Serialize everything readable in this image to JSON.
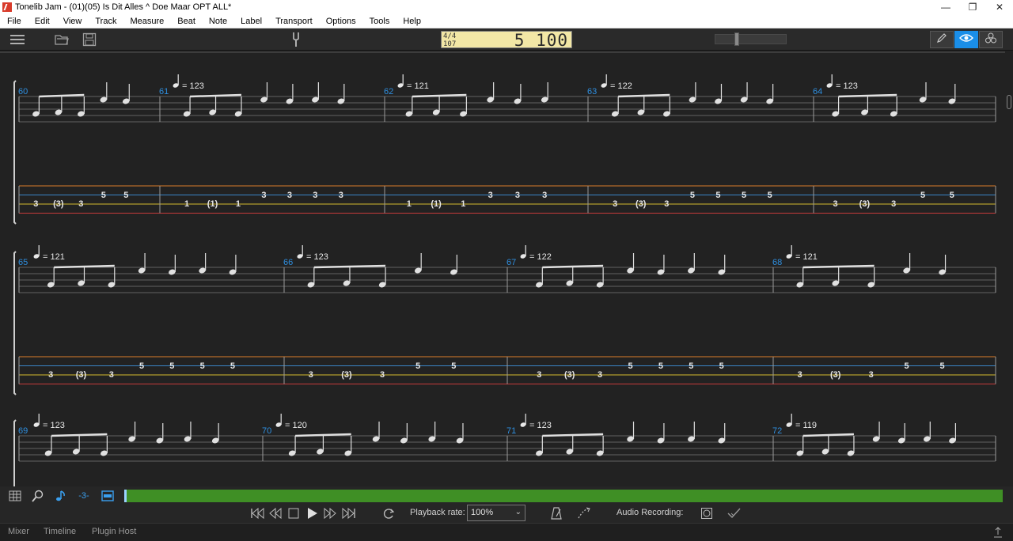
{
  "window": {
    "title": "Tonelib Jam - (01)(05) Is Dit Alles ^ Doe Maar OPT ALL*"
  },
  "menu": [
    "File",
    "Edit",
    "View",
    "Track",
    "Measure",
    "Beat",
    "Note",
    "Label",
    "Transport",
    "Options",
    "Tools",
    "Help"
  ],
  "toolbar": {
    "icons": [
      "hamburger-menu-icon",
      "open-folder-icon",
      "save-icon",
      "tuning-fork-icon",
      "pencil-icon",
      "eye-icon",
      "tracks-icon"
    ],
    "time_signature": "4/4",
    "tempo_display": "107",
    "position": "5 100"
  },
  "score": {
    "systems": [
      {
        "measures": [
          {
            "number": "60",
            "tempo": "",
            "tab": [
              [
                "3",
                "(3)",
                "3"
              ],
              [
                "5",
                "5"
              ]
            ]
          },
          {
            "number": "61",
            "tempo": "= 123",
            "tab": [
              [
                "1",
                "(1)",
                "1"
              ],
              [
                "3",
                "3",
                "3",
                "3"
              ]
            ]
          },
          {
            "number": "62",
            "tempo": "= 121",
            "tab": [
              [
                "1",
                "(1)",
                "1"
              ],
              [
                "3",
                "3",
                "3"
              ]
            ]
          },
          {
            "number": "63",
            "tempo": "= 122",
            "tab": [
              [
                "3",
                "(3)",
                "3"
              ],
              [
                "5",
                "5",
                "5",
                "5"
              ]
            ]
          },
          {
            "number": "64",
            "tempo": "= 123",
            "tab": [
              [
                "3",
                "(3)",
                "3"
              ],
              [
                "5",
                "5"
              ]
            ]
          }
        ]
      },
      {
        "measures": [
          {
            "number": "65",
            "tempo": "= 121",
            "tab": [
              [
                "3",
                "(3)",
                "3"
              ],
              [
                "5",
                "5",
                "5",
                "5"
              ]
            ]
          },
          {
            "number": "66",
            "tempo": "= 123",
            "tab": [
              [
                "3",
                "(3)",
                "3"
              ],
              [
                "5",
                "5"
              ]
            ]
          },
          {
            "number": "67",
            "tempo": "= 122",
            "tab": [
              [
                "3",
                "(3)",
                "3"
              ],
              [
                "5",
                "5",
                "5",
                "5"
              ]
            ]
          },
          {
            "number": "68",
            "tempo": "= 121",
            "tab": [
              [
                "3",
                "(3)",
                "3"
              ],
              [
                "5",
                "5"
              ]
            ]
          }
        ]
      },
      {
        "measures": [
          {
            "number": "69",
            "tempo": "= 123"
          },
          {
            "number": "70",
            "tempo": "= 120"
          },
          {
            "number": "71",
            "tempo": "= 123"
          },
          {
            "number": "72",
            "tempo": "= 119"
          }
        ]
      }
    ]
  },
  "bottom_toolbar": {
    "icons": [
      "grid-icon",
      "zoom-icon",
      "note-icon",
      "triplet-icon",
      "panel-icon"
    ]
  },
  "transport": {
    "icons": [
      "skip-start-icon",
      "rewind-icon",
      "stop-icon",
      "play-icon",
      "fast-forward-icon",
      "skip-end-icon",
      "loop-icon",
      "metronome-icon",
      "count-in-icon"
    ],
    "playback_rate_label": "Playback rate:",
    "playback_rate_value": "100%",
    "audio_recording_label": "Audio Recording:"
  },
  "status_tabs": [
    "Mixer",
    "Timeline",
    "Plugin Host"
  ],
  "colors": {
    "background": "#222222",
    "measure_number": "#2f8fe0",
    "active_mode": "#1a8ee8",
    "timeline": "#3f8f25",
    "lcd": "#f2e7a6",
    "tab_string_1": "#d97c2b",
    "tab_string_2": "#3b86c8",
    "tab_string_3": "#d4b92e",
    "tab_string_4": "#c63a3a"
  }
}
